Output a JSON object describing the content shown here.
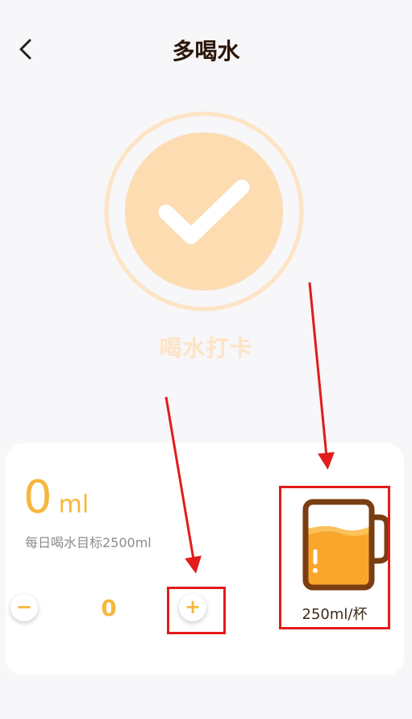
{
  "header": {
    "back_icon": "chevron-left-icon",
    "title": "多喝水"
  },
  "checkin": {
    "icon": "checkmark-icon",
    "label": "喝水打卡"
  },
  "card": {
    "amount_value": "0",
    "amount_unit": "ml",
    "goal_text": "每日喝水目标2500ml",
    "minus_label": "−",
    "plus_label": "+",
    "count": "0",
    "cup_icon": "water-cup-icon",
    "cup_label": "250ml/杯"
  },
  "colors": {
    "accent": "#f6b73c",
    "checkin_ring": "#fde4c4",
    "checkin_fill": "#fddcb2",
    "cup_outline": "#7a3e12",
    "cup_water": "#f9a72c",
    "annotation": "#e31b1b"
  }
}
